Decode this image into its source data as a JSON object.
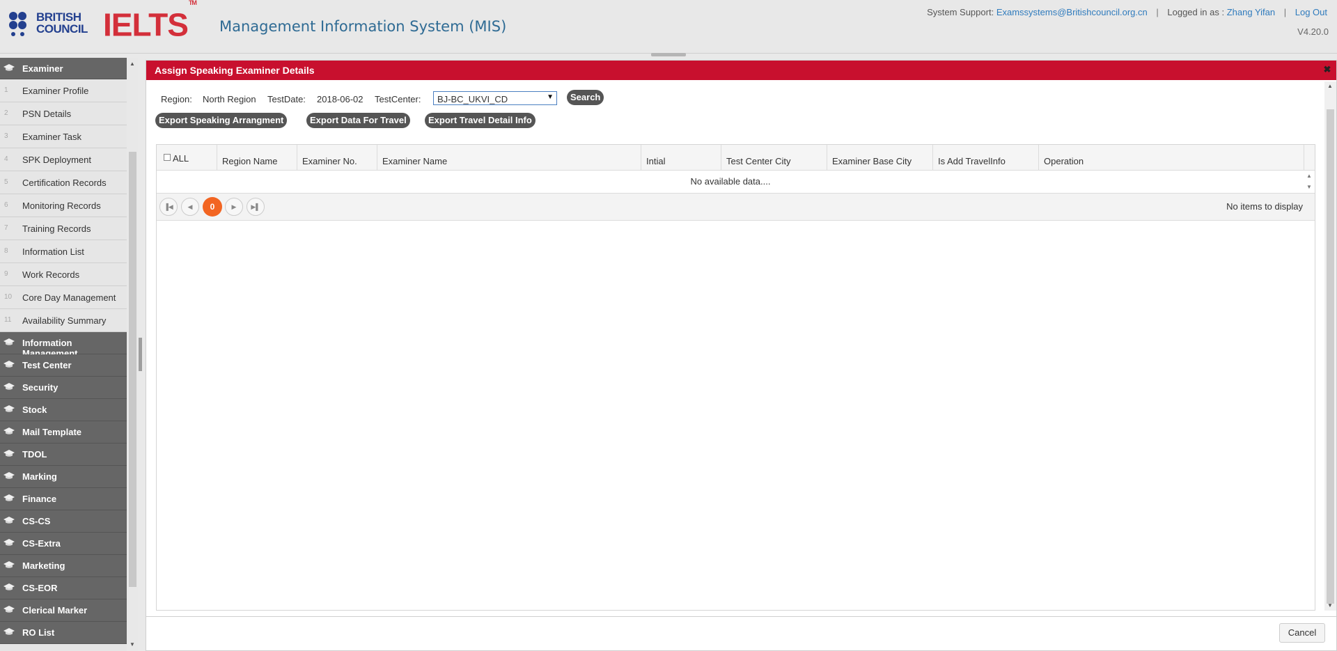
{
  "header": {
    "logo_brand_line1": "BRITISH",
    "logo_brand_line2": "COUNCIL",
    "logo_ielts": "IELTS",
    "logo_tm": "TM",
    "app_title": "Management Information System (MIS)",
    "support_label": "System Support:",
    "support_email": "Examssystems@Britishcouncil.org.cn",
    "logged_in_label": "Logged in as :",
    "user_name": "Zhang Yifan",
    "logout": "Log Out",
    "version": "V4.20.0"
  },
  "sidebar": {
    "active_category": "Examiner",
    "sub_items": [
      {
        "num": "1",
        "label": "Examiner Profile"
      },
      {
        "num": "2",
        "label": "PSN Details"
      },
      {
        "num": "3",
        "label": "Examiner Task"
      },
      {
        "num": "4",
        "label": "SPK Deployment"
      },
      {
        "num": "5",
        "label": "Certification Records"
      },
      {
        "num": "6",
        "label": "Monitoring Records"
      },
      {
        "num": "7",
        "label": "Training Records"
      },
      {
        "num": "8",
        "label": "Information List"
      },
      {
        "num": "9",
        "label": "Work Records"
      },
      {
        "num": "10",
        "label": "Core Day Management"
      },
      {
        "num": "11",
        "label": "Availability Summary"
      }
    ],
    "categories": [
      "Information Management",
      "Test Center",
      "Security",
      "Stock",
      "Mail Template",
      "TDOL",
      "Marking",
      "Finance",
      "CS-CS",
      "CS-Extra",
      "Marketing",
      "CS-EOR",
      "Clerical Marker",
      "RO List"
    ]
  },
  "dialog": {
    "title": "Assign Speaking Examiner Details",
    "close_glyph": "✖",
    "region_label": "Region:",
    "region_value": "North Region",
    "testdate_label": "TestDate:",
    "testdate_value": "2018-06-02",
    "testcenter_label": "TestCenter:",
    "testcenter_value": "BJ-BC_UKVI_CD",
    "search_button": "Search",
    "export_buttons": [
      "Export Speaking Arrangment",
      "Export Data For Travel",
      "Export Travel Detail Info"
    ],
    "grid": {
      "columns": [
        "ALL",
        "Region Name",
        "Examiner No.",
        "Examiner Name",
        "Intial",
        "Test Center City",
        "Examiner Base City",
        "Is Add TravelInfo",
        "Operation"
      ],
      "empty_text": "No available data....",
      "current_page": "0",
      "pager_info": "No items to display"
    },
    "cancel_button": "Cancel"
  },
  "colors": {
    "dialog_header": "#c8102e",
    "sidebar_category": "#666666",
    "pager_current": "#f26522",
    "brand_blue": "#23408f",
    "ielts_red": "#d32f3a"
  }
}
